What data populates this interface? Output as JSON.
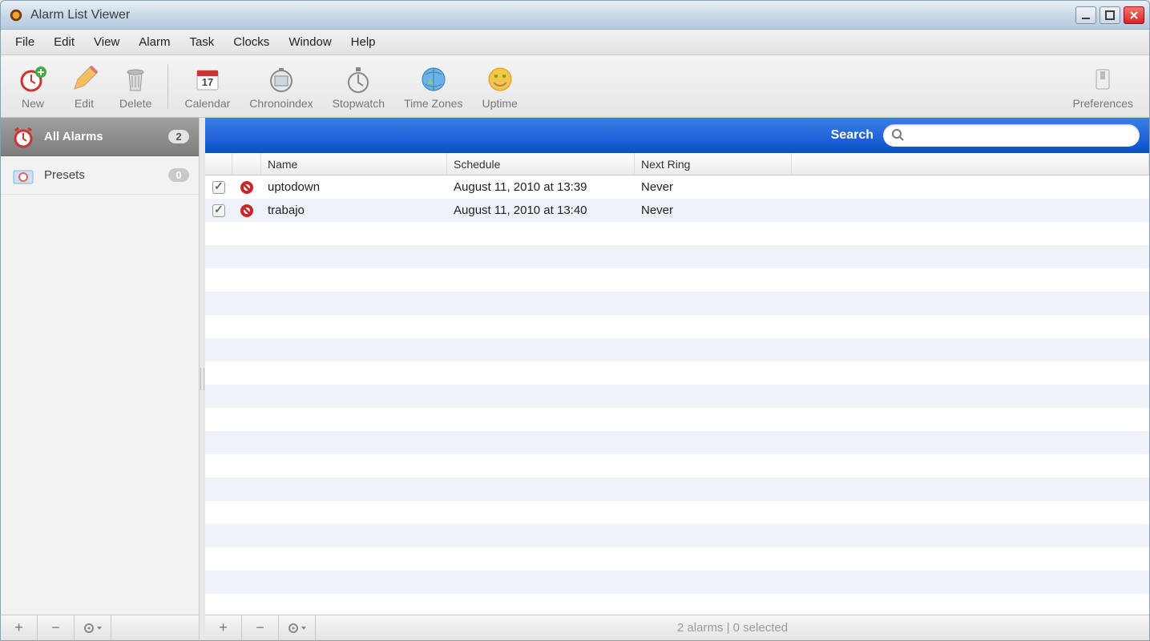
{
  "window": {
    "title": "Alarm List Viewer"
  },
  "menu": {
    "file": "File",
    "edit": "Edit",
    "view": "View",
    "alarm": "Alarm",
    "task": "Task",
    "clocks": "Clocks",
    "window": "Window",
    "help": "Help"
  },
  "toolbar": {
    "new": "New",
    "edit": "Edit",
    "delete": "Delete",
    "calendar": "Calendar",
    "calendar_day": "17",
    "chronoindex": "Chronoindex",
    "stopwatch": "Stopwatch",
    "timezones": "Time Zones",
    "uptime": "Uptime",
    "preferences": "Preferences"
  },
  "sidebar": {
    "all_alarms": {
      "label": "All Alarms",
      "count": "2"
    },
    "presets": {
      "label": "Presets",
      "count": "0"
    }
  },
  "search": {
    "label": "Search",
    "placeholder": ""
  },
  "table": {
    "headers": {
      "name": "Name",
      "schedule": "Schedule",
      "next_ring": "Next Ring"
    },
    "rows": [
      {
        "checked": true,
        "name": "uptodown",
        "schedule": "August 11, 2010 at 13:39",
        "next_ring": "Never"
      },
      {
        "checked": true,
        "name": "trabajo",
        "schedule": "August 11, 2010 at 13:40",
        "next_ring": "Never"
      }
    ]
  },
  "status": {
    "text": "2 alarms | 0 selected"
  }
}
